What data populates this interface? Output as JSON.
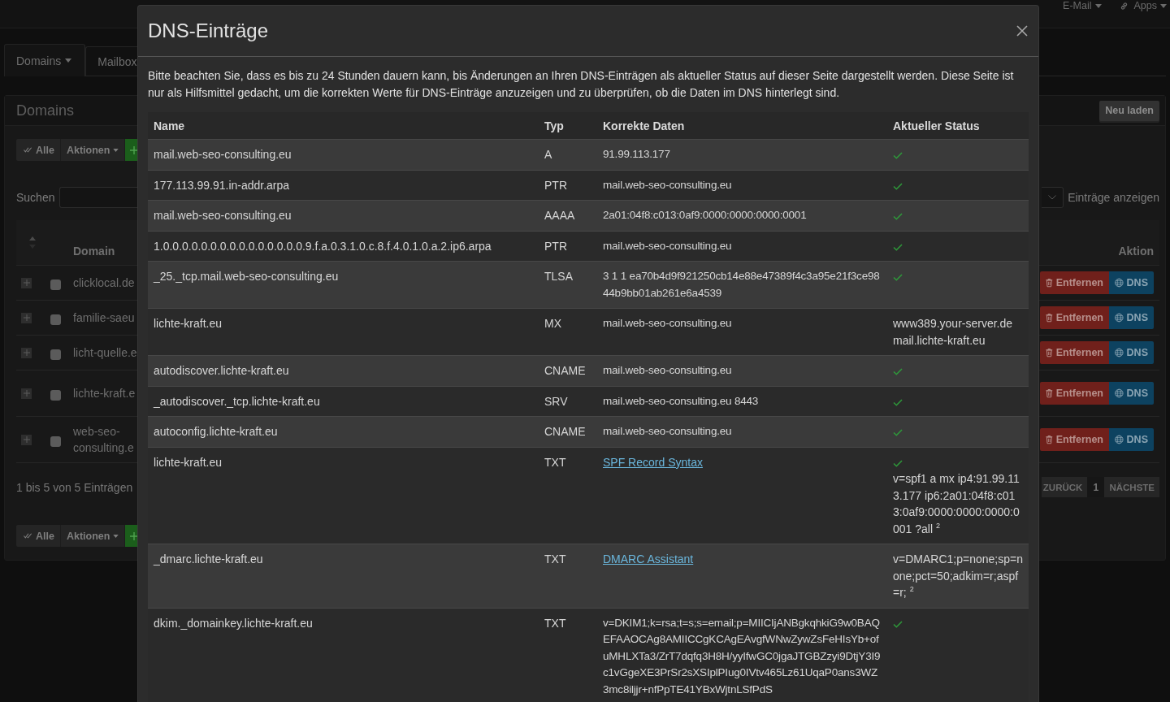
{
  "navbar": {
    "items": [
      {
        "label": "E-Mail",
        "kind": "menu"
      },
      {
        "label": "Apps",
        "kind": "apps"
      }
    ]
  },
  "tabs": [
    {
      "label": "Domains",
      "selected": true,
      "dropdown": true
    },
    {
      "label": "Mailbox",
      "selected": false,
      "dropdown": false
    }
  ],
  "domains_panel": {
    "title": "Domains",
    "reload_button": "Neu laden",
    "top_toolbar": {
      "select_all": "Alle",
      "actions": "Aktionen"
    },
    "search": {
      "label": "Suchen"
    },
    "page_length": {
      "label": "Einträge anzeigen"
    },
    "columns": [
      "Domain",
      "Aktion"
    ],
    "rows": [
      {
        "domain": "clicklocal.de",
        "checked": false,
        "remove": "Entfernen",
        "dns": "DNS"
      },
      {
        "domain": "familie-saeu",
        "checked": false,
        "remove": "Entfernen",
        "dns": "DNS"
      },
      {
        "domain": "licht-quelle.e",
        "checked": false,
        "remove": "Entfernen",
        "dns": "DNS"
      },
      {
        "domain": "lichte-kraft.e",
        "checked": false,
        "remove": "Entfernen",
        "dns": "DNS"
      },
      {
        "domain": "web-seo-consulting.e",
        "checked": false,
        "remove": "Entfernen",
        "dns": "DNS"
      }
    ],
    "info": "1 bis 5 von 5 Einträgen",
    "pagination": {
      "previous": "ZURÜCK",
      "pages": [
        {
          "label": "1",
          "selected": true
        }
      ],
      "next": "NÄCHSTE"
    },
    "bottom_toolbar": {
      "select_all": "Alle",
      "actions": "Aktionen"
    }
  },
  "dns_dialog": {
    "title": "DNS-Einträge",
    "notice": "Bitte beachten Sie, dass es bis zu 24 Stunden dauern kann, bis Änderungen an Ihren DNS-Einträgen als aktueller Status auf dieser Seite dargestellt werden. Diese Seite ist nur als Hilfsmittel gedacht, um die korrekten Werte für DNS-Einträge anzuzeigen und zu überprüfen, ob die Daten im DNS hinterlegt sind.",
    "columns": [
      "Name",
      "Typ",
      "Korrekte Daten",
      "Aktueller Status"
    ],
    "records": [
      {
        "name": "mail.web-seo-consulting.eu",
        "type": "A",
        "data": {
          "kind": "text",
          "text": "91.99.113.177"
        },
        "verified": true
      },
      {
        "name": "177.113.99.91.in-addr.arpa",
        "type": "PTR",
        "data": {
          "kind": "text",
          "text": "mail.web-seo-consulting.eu"
        },
        "verified": true
      },
      {
        "name": "mail.web-seo-consulting.eu",
        "type": "AAAA",
        "data": {
          "kind": "text",
          "text": "2a01:04f8:c013:0af9:0000:0000:0000:0001"
        },
        "verified": true
      },
      {
        "name": "1.0.0.0.0.0.0.0.0.0.0.0.0.0.0.0.9.f.a.0.3.1.0.c.8.f.4.0.1.0.a.2.ip6.arpa",
        "type": "PTR",
        "data": {
          "kind": "text",
          "text": "mail.web-seo-consulting.eu"
        },
        "verified": true
      },
      {
        "name": "_25._tcp.mail.web-seo-consulting.eu",
        "type": "TLSA",
        "data": {
          "kind": "text",
          "text": "3 1 1 ea70b4d9f921250cb14e88e47389f4c3a95e21f3ce9844b9bb01ab261e6a4539"
        },
        "verified": true
      },
      {
        "name": "lichte-kraft.eu",
        "type": "MX",
        "data": {
          "kind": "text",
          "text": "mail.web-seo-consulting.eu"
        },
        "verified": false,
        "current": [
          "www389.your-server.de",
          "mail.lichte-kraft.eu"
        ]
      },
      {
        "name": "autodiscover.lichte-kraft.eu",
        "type": "CNAME",
        "data": {
          "kind": "text",
          "text": "mail.web-seo-consulting.eu"
        },
        "verified": true
      },
      {
        "name": "_autodiscover._tcp.lichte-kraft.eu",
        "type": "SRV",
        "data": {
          "kind": "text",
          "text": "mail.web-seo-consulting.eu 8443"
        },
        "verified": true
      },
      {
        "name": "autoconfig.lichte-kraft.eu",
        "type": "CNAME",
        "data": {
          "kind": "text",
          "text": "mail.web-seo-consulting.eu"
        },
        "verified": true
      },
      {
        "name": "lichte-kraft.eu",
        "type": "TXT",
        "data": {
          "kind": "link",
          "text": "SPF Record Syntax"
        },
        "verified": true,
        "current": [
          "v=spf1 a mx ip4:91.99.113.177 ip6:2a01:04f8:c013:0af9:0000:0000:0000:0001 ?all $^{2}$"
        ]
      },
      {
        "name": "_dmarc.lichte-kraft.eu",
        "type": "TXT",
        "data": {
          "kind": "link",
          "text": "DMARC Assistant"
        },
        "verified": false,
        "current": [
          "v=DMARC1;p=none;sp=none;pct=50;adkim=r;aspf=r; $^{2}$"
        ]
      },
      {
        "name": "dkim._domainkey.lichte-kraft.eu",
        "type": "TXT",
        "data": {
          "kind": "text",
          "text": "v=DKIM1;k=rsa;t=s;s=email;p=MIICIjANBgkqhkiG9w0BAQEFAAOCAg8AMIICCgKCAgEAvgfWNwZywZsFeHIsYb+ofuMHLXTa3/ZrT7dqfq3H8H/yyIfwGC0jgaJTGBZzyi9DtjY3I9c1vGgeXE3PrSr2sXSIplPIug0IVtv465Lz61UqaP0ans3WZ3mc8iljjr+nfPpTE41YBxWjtnLSfPdS"
        },
        "verified": true
      }
    ]
  }
}
